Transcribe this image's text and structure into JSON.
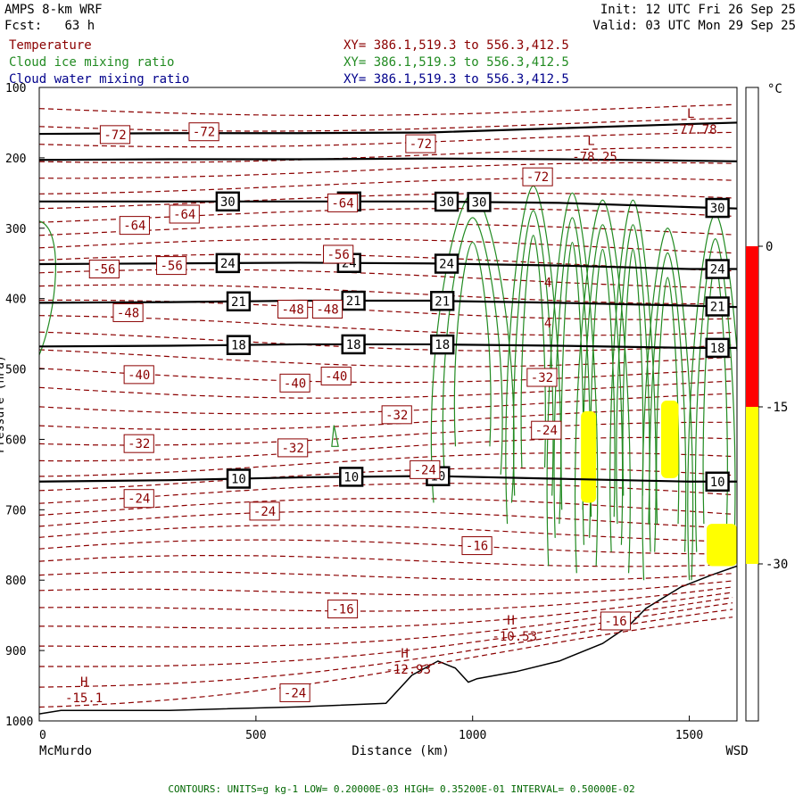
{
  "header": {
    "model": "AMPS 8-km WRF",
    "forecast_label": "Fcst:",
    "forecast_hours": "63 h",
    "init": "Init: 12 UTC Fri 26 Sep 25",
    "valid": "Valid: 03 UTC Mon 29 Sep 25"
  },
  "fields": [
    {
      "name": "Temperature",
      "xy": "",
      "color": "#8B0000"
    },
    {
      "name": "Cloud ice mixing ratio",
      "xy": "XY= 386.1,519.3 to 556.3,412.5",
      "color": "#228B22"
    },
    {
      "name": "Cloud water mixing ratio",
      "xy": "XY= 386.1,519.3 to 556.3,412.5",
      "color": "#00008B"
    }
  ],
  "temperature_xy": "XY= 386.1,519.3 to 556.3,412.5",
  "footer": "CONTOURS: UNITS=g kg-1  LOW= 0.20000E-03  HIGH= 0.35200E-01  INTERVAL= 0.50000E-02",
  "chart_data": {
    "type": "contour",
    "xlabel": "Distance (km)",
    "ylabel": "Pressure (hPa)",
    "xlim": [
      0,
      1610
    ],
    "ylim": [
      100,
      1000
    ],
    "x_ticks": [
      "0",
      "500",
      "1000",
      "1500"
    ],
    "y_ticks": [
      "100",
      "200",
      "300",
      "400",
      "500",
      "600",
      "700",
      "800",
      "900",
      "1000"
    ],
    "y_ticks_values": [
      100,
      200,
      300,
      400,
      500,
      600,
      700,
      800,
      900,
      1000
    ],
    "x_ticks_values": [
      0,
      500,
      1000,
      1500
    ],
    "endpoints": {
      "left": "McMurdo",
      "right": "WSD"
    },
    "colorbar": {
      "unit": "°C",
      "labels": [
        "0",
        "-15",
        "-30"
      ],
      "bands": [
        {
          "from": 0,
          "to": -15,
          "color": "#ff0000"
        },
        {
          "from": -15,
          "to": -30,
          "color": "#ffff00"
        }
      ]
    },
    "temperature_labels": [
      {
        "x": 175,
        "p": 167,
        "value": "-72"
      },
      {
        "x": 380,
        "p": 163,
        "value": "-72"
      },
      {
        "x": 880,
        "p": 180,
        "value": "-72"
      },
      {
        "x": 1150,
        "p": 227,
        "value": "-72"
      },
      {
        "x": 220,
        "p": 296,
        "value": "-64"
      },
      {
        "x": 335,
        "p": 280,
        "value": "-64"
      },
      {
        "x": 700,
        "p": 264,
        "value": "-64"
      },
      {
        "x": 150,
        "p": 358,
        "value": "-56"
      },
      {
        "x": 305,
        "p": 353,
        "value": "-56"
      },
      {
        "x": 690,
        "p": 337,
        "value": "-56"
      },
      {
        "x": 205,
        "p": 420,
        "value": "-48"
      },
      {
        "x": 585,
        "p": 415,
        "value": "-48"
      },
      {
        "x": 665,
        "p": 415,
        "value": "-48"
      },
      {
        "x": 230,
        "p": 508,
        "value": "-40"
      },
      {
        "x": 590,
        "p": 520,
        "value": "-40"
      },
      {
        "x": 685,
        "p": 510,
        "value": "-40"
      },
      {
        "x": 825,
        "p": 565,
        "value": "-32"
      },
      {
        "x": 230,
        "p": 606,
        "value": "-32"
      },
      {
        "x": 585,
        "p": 612,
        "value": "-32"
      },
      {
        "x": 1160,
        "p": 512,
        "value": "-32"
      },
      {
        "x": 230,
        "p": 684,
        "value": "-24"
      },
      {
        "x": 520,
        "p": 702,
        "value": "-24"
      },
      {
        "x": 890,
        "p": 643,
        "value": "-24"
      },
      {
        "x": 1170,
        "p": 587,
        "value": "-24"
      },
      {
        "x": 590,
        "p": 960,
        "value": "-24"
      },
      {
        "x": 1010,
        "p": 751,
        "value": "-16"
      },
      {
        "x": 700,
        "p": 841,
        "value": "-16"
      },
      {
        "x": 1330,
        "p": 858,
        "value": "-16"
      }
    ],
    "cloud_labels": [
      {
        "x": 1165,
        "p": 383,
        "value": "4"
      },
      {
        "x": 1165,
        "p": 441,
        "value": "4"
      }
    ],
    "temperature_extrema": [
      {
        "x": 1505,
        "p": 153,
        "type": "L",
        "value": "-77.78"
      },
      {
        "x": 1275,
        "p": 192,
        "type": "L",
        "value": "-78.25"
      },
      {
        "x": 1090,
        "p": 873,
        "type": "H",
        "value": "-10.53"
      },
      {
        "x": 845,
        "p": 920,
        "type": "H",
        "value": "-12.93"
      },
      {
        "x": 105,
        "p": 961,
        "type": "H",
        "value": "-15.1"
      }
    ],
    "height_lines": [
      {
        "label": "30",
        "p": [
          262,
          262,
          262,
          262,
          264,
          270,
          272
        ],
        "marks": [
          435,
          715,
          940,
          1015,
          1565
        ]
      },
      {
        "label": "24",
        "p": [
          351,
          350,
          349,
          350,
          353,
          358,
          358
        ],
        "marks": [
          435,
          715,
          940,
          1565
        ]
      },
      {
        "label": "21",
        "p": [
          406,
          405,
          403,
          403,
          406,
          410,
          412
        ],
        "marks": [
          460,
          725,
          930,
          1565
        ]
      },
      {
        "label": "18",
        "p": [
          468,
          467,
          465,
          465,
          467,
          470,
          470
        ],
        "marks": [
          460,
          725,
          930,
          1565
        ]
      },
      {
        "label": "10",
        "p": [
          660,
          658,
          654,
          652,
          656,
          660,
          660
        ],
        "marks": [
          460,
          720,
          920,
          1565
        ]
      }
    ],
    "height_line_x": [
      0,
      300,
      600,
      900,
      1200,
      1500,
      1610
    ],
    "reference_lines": [
      {
        "p": [
          166,
          165,
          165,
          164,
          158,
          152,
          150
        ]
      },
      {
        "p": [
          203,
          202,
          202,
          201,
          202,
          204,
          205
        ]
      }
    ],
    "terrain": [
      [
        0,
        990
      ],
      [
        50,
        985
      ],
      [
        300,
        985
      ],
      [
        600,
        980
      ],
      [
        800,
        975
      ],
      [
        860,
        935
      ],
      [
        920,
        915
      ],
      [
        960,
        925
      ],
      [
        990,
        945
      ],
      [
        1010,
        940
      ],
      [
        1100,
        930
      ],
      [
        1200,
        915
      ],
      [
        1300,
        890
      ],
      [
        1360,
        865
      ],
      [
        1400,
        840
      ],
      [
        1480,
        810
      ],
      [
        1550,
        793
      ],
      [
        1610,
        780
      ]
    ],
    "supercooled_regions": [
      {
        "x": [
          1250,
          1285
        ],
        "p": [
          560,
          690
        ]
      },
      {
        "x": [
          1435,
          1475
        ],
        "p": [
          545,
          655
        ]
      },
      {
        "x": [
          1540,
          1610
        ],
        "p": [
          720,
          780
        ]
      }
    ]
  }
}
